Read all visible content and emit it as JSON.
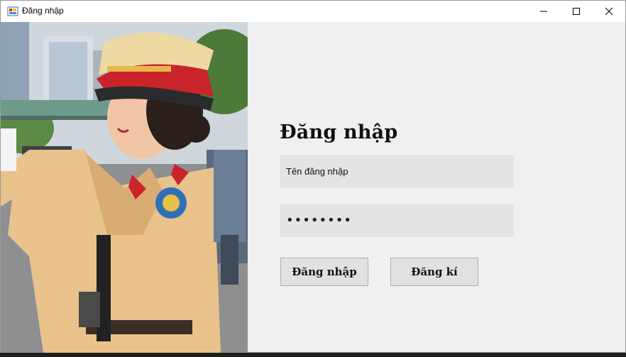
{
  "window": {
    "title": "Đăng nhập",
    "icon": "app-form-icon"
  },
  "caption_buttons": {
    "minimize": "minimize-icon",
    "maximize": "maximize-icon",
    "close": "close-icon"
  },
  "form": {
    "heading": "Đăng nhập",
    "username": {
      "value": "Tên đăng nhập"
    },
    "password": {
      "value": "••••••••"
    },
    "login_button": "Đăng nhập",
    "register_button": "Đăng kí"
  },
  "image": {
    "subject": "officer-photo"
  }
}
